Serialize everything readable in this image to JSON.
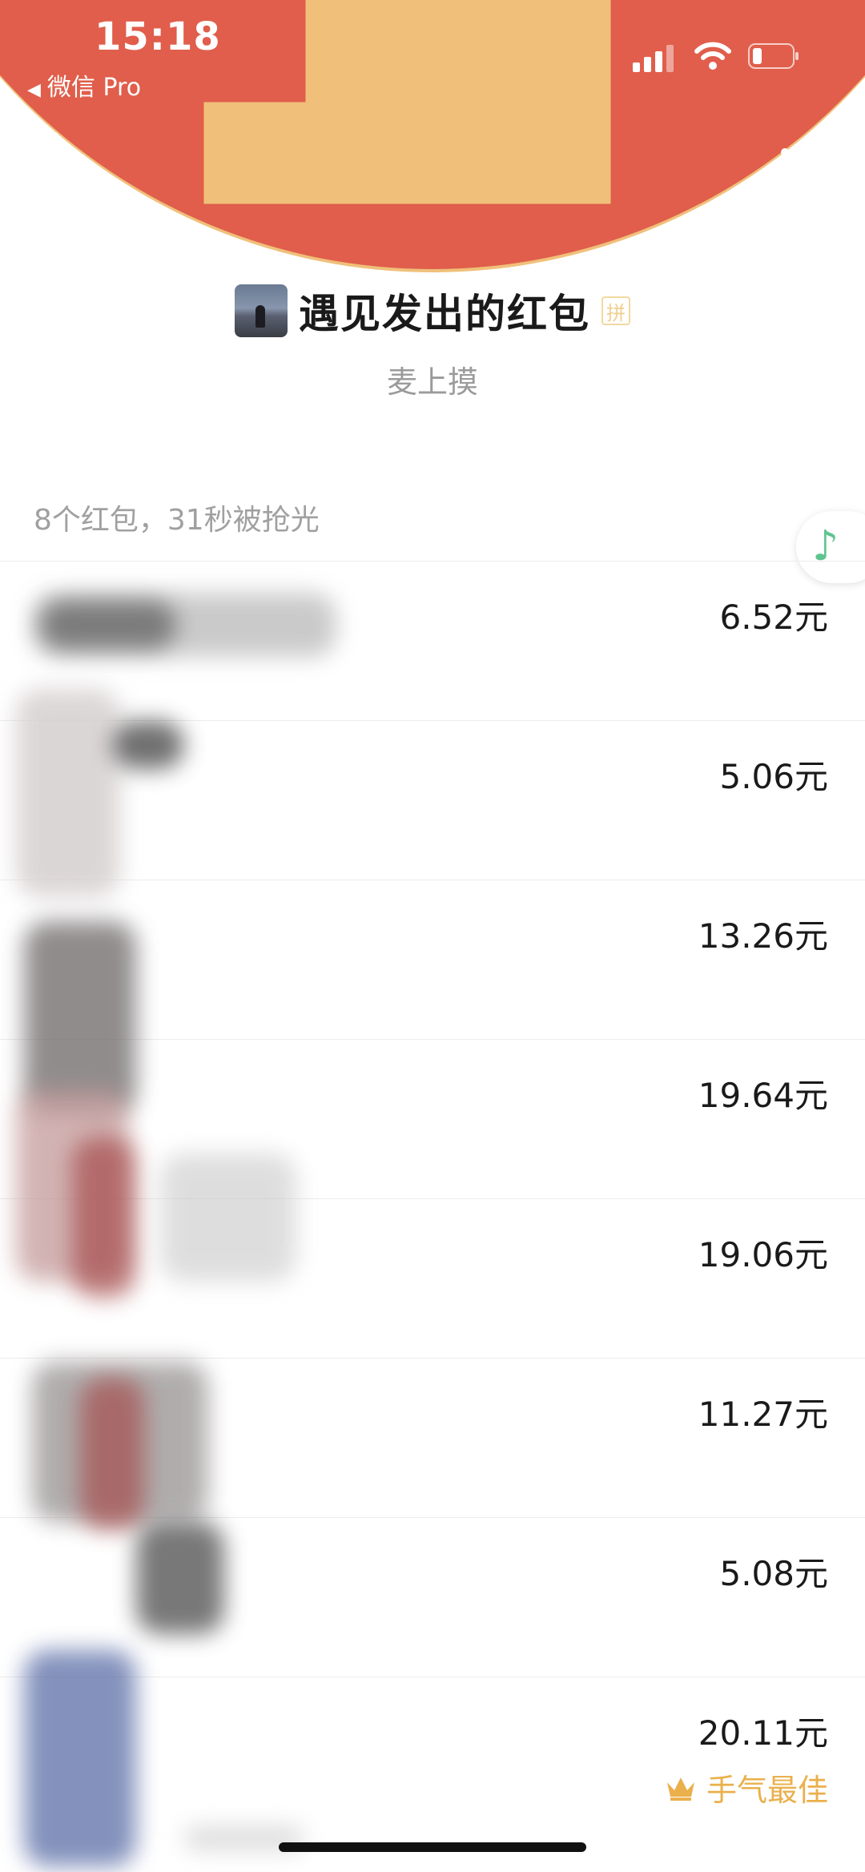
{
  "status_bar": {
    "time": "15:18",
    "back_app": "微信 Pro"
  },
  "header": {
    "title": "遇见发出的红包",
    "pin_badge": "拼",
    "greeting": "麦上摸",
    "colors": {
      "header_red": "#e05e4b",
      "rim_gold": "#f0c07a"
    }
  },
  "summary": "8个红包，31秒被抢光",
  "music_icon": "music-note-icon",
  "records": [
    {
      "amount": "6.52元"
    },
    {
      "amount": "5.06元"
    },
    {
      "amount": "13.26元"
    },
    {
      "amount": "19.64元"
    },
    {
      "amount": "19.06元"
    },
    {
      "amount": "11.27元"
    },
    {
      "amount": "5.08元"
    },
    {
      "amount": "20.11元",
      "best_label": "手气最佳"
    }
  ],
  "colors": {
    "best_gold": "#eab04c",
    "music_green": "#5fc48f"
  }
}
